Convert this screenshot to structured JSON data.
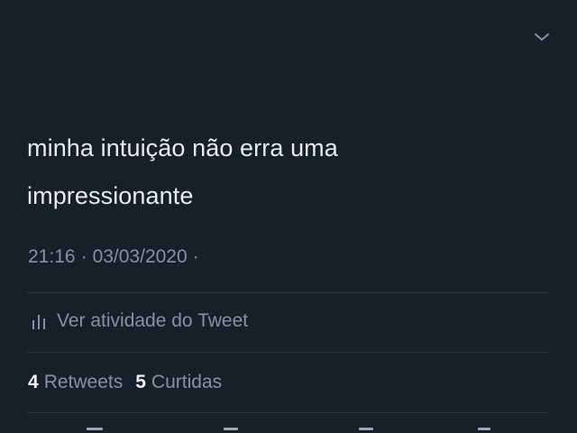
{
  "tweet": {
    "text_lines": [
      "minha intuição não erra uma",
      "impressionante"
    ],
    "time": "21:16",
    "date": "03/03/2020",
    "separator": "·"
  },
  "activity": {
    "label": "Ver atividade do Tweet",
    "icon": "bar-chart-icon"
  },
  "stats": {
    "retweets_count": "4",
    "retweets_label": "Retweets",
    "likes_count": "5",
    "likes_label": "Curtidas"
  },
  "icons": {
    "menu": "chevron-down-icon",
    "reply": "reply-icon",
    "retweet": "retweet-icon",
    "like": "like-icon",
    "share": "share-icon"
  },
  "colors": {
    "background": "#16202b",
    "text_primary": "#e6ebf0",
    "text_secondary": "#8393a3",
    "divider": "#2c3a48"
  }
}
